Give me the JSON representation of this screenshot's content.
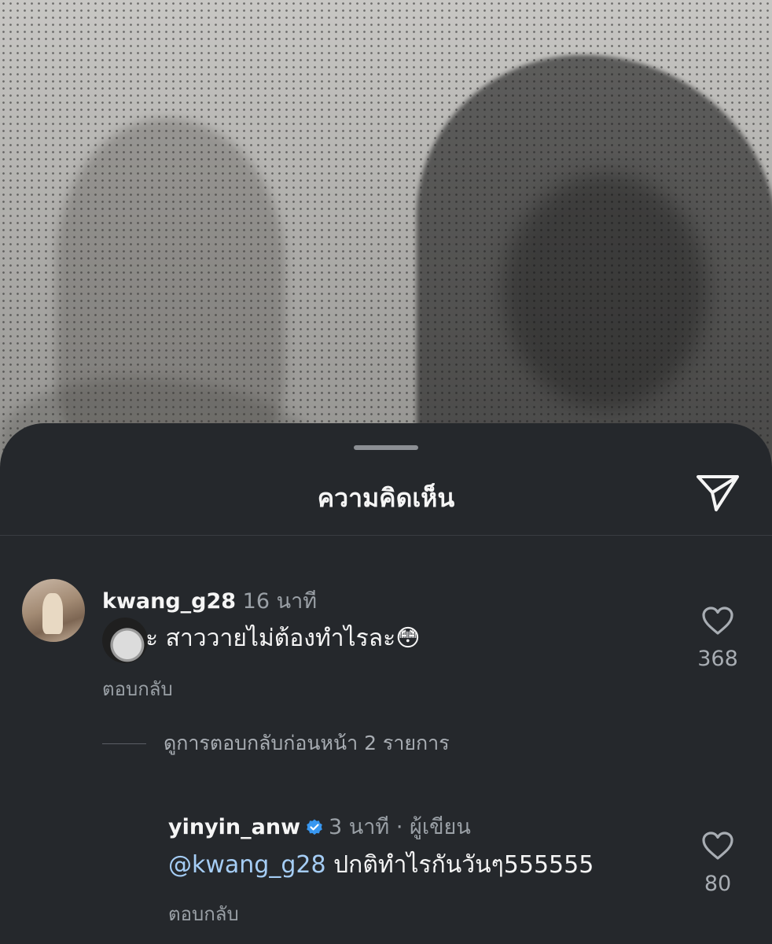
{
  "sheet": {
    "title": "ความคิดเห็น",
    "share_icon": "paper-plane-icon"
  },
  "comments": [
    {
      "username": "kwang_g28",
      "time": "16 นาที",
      "text": "จบละ สาววายไม่ต้องทำไรละ",
      "emoji": "😳",
      "reply_label": "ตอบกลับ",
      "likes": "368"
    }
  ],
  "view_replies_label": "ดูการตอบกลับก่อนหน้า 2 รายการ",
  "reply": {
    "username": "yinyin_anw",
    "verified": true,
    "time": "3 นาที",
    "separator": "·",
    "author_label": "ผู้เขียน",
    "mention": "@kwang_g28",
    "text": "ปกติทำไรกันวันๆ555555",
    "reply_label": "ตอบกลับ",
    "likes": "80"
  },
  "colors": {
    "sheet_bg": "#25282c",
    "mention": "#a5cdf5",
    "verified": "#3897f0",
    "muted": "#9aa0a6"
  }
}
